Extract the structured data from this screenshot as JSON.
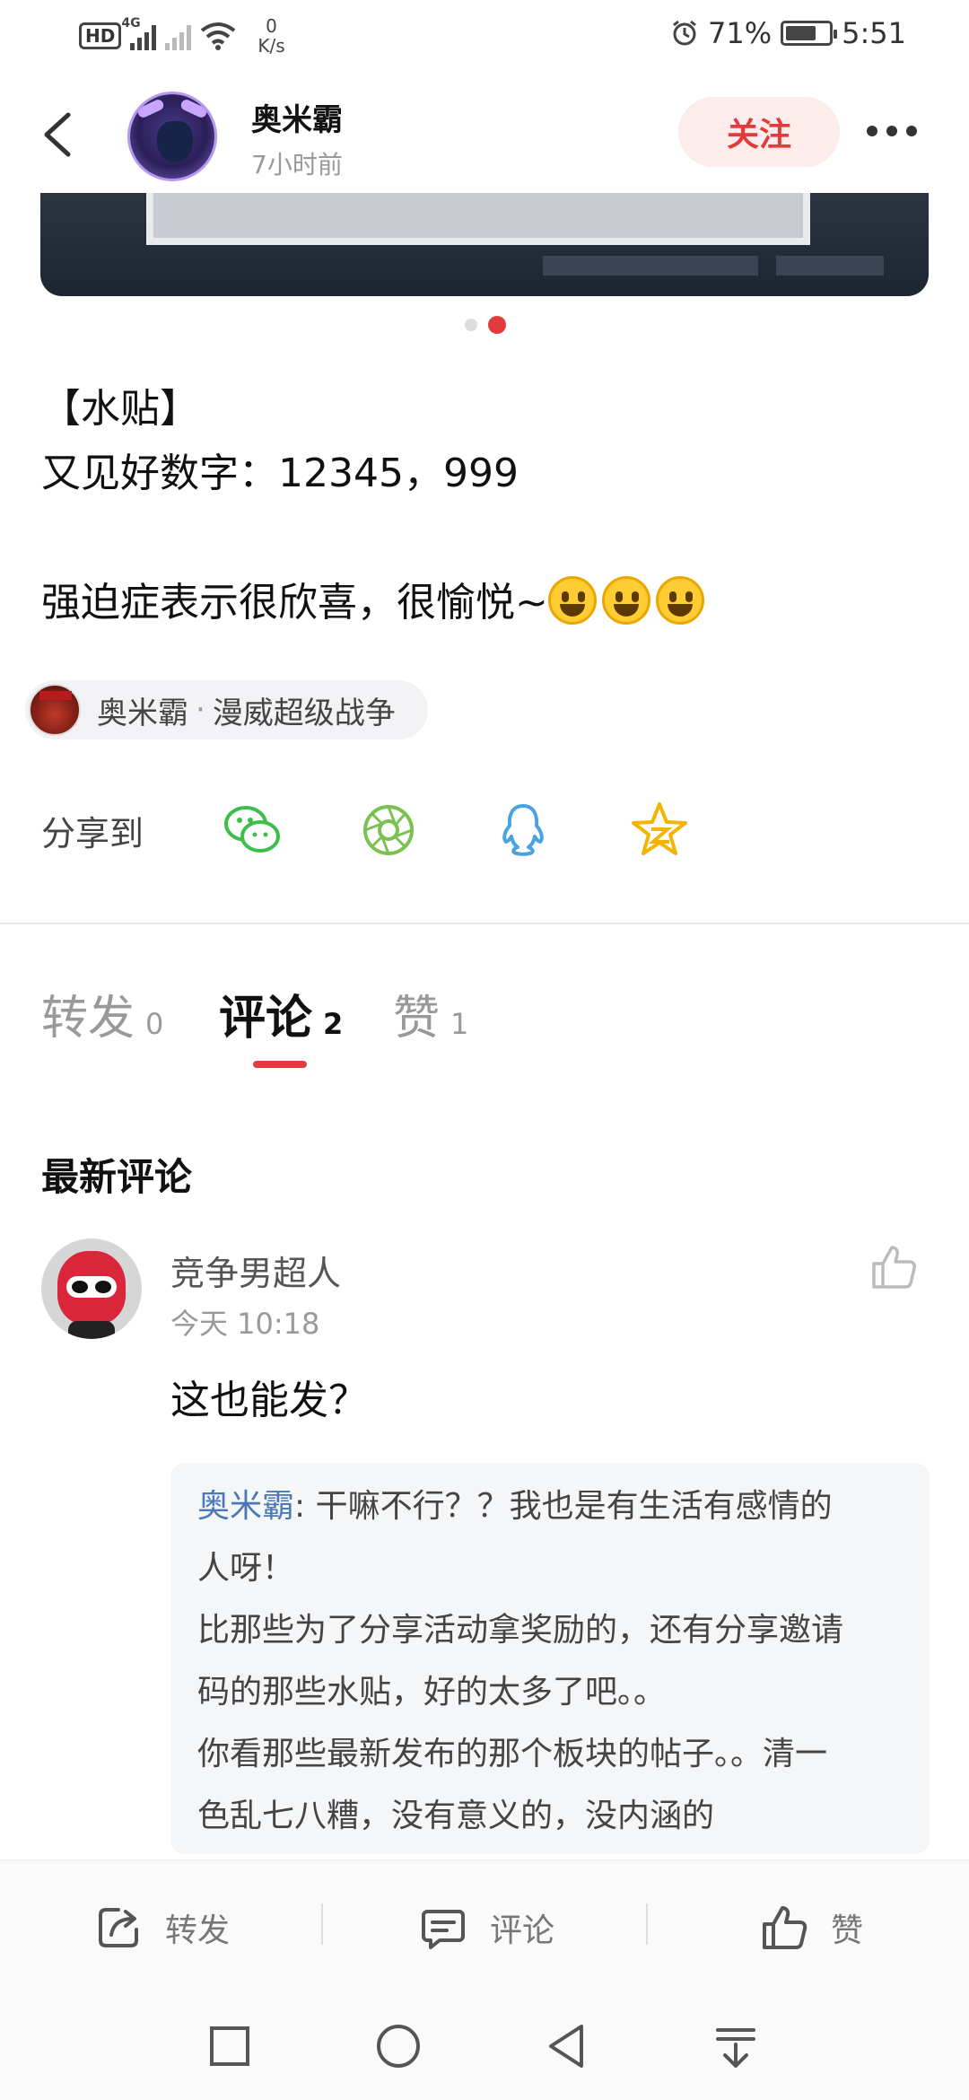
{
  "status_bar": {
    "hd": "HD",
    "network": "4G",
    "speed_value": "0",
    "speed_unit": "K/s",
    "battery_percent": "71%",
    "battery_level": 0.71,
    "time": "5:51"
  },
  "header": {
    "author_name": "奥米霸",
    "post_time": "7小时前",
    "follow_label": "关注"
  },
  "carousel": {
    "total": 2,
    "active_index": 1
  },
  "post": {
    "line1": "【水贴】",
    "line2": "又见好数字：12345，999",
    "line3": "",
    "line4": "强迫症表示很欣喜，很愉悦~"
  },
  "topic": {
    "author": "奥米霸",
    "separator": "·",
    "game": "漫威超级战争"
  },
  "share": {
    "label": "分享到",
    "targets": [
      "wechat-icon",
      "moments-icon",
      "qq-icon",
      "qzone-icon"
    ]
  },
  "tabs": [
    {
      "label": "转发",
      "count": "0"
    },
    {
      "label": "评论",
      "count": "2"
    },
    {
      "label": "赞",
      "count": "1"
    }
  ],
  "comments_section": {
    "title": "最新评论"
  },
  "comment": {
    "user": "竞争男超人",
    "time": "今天 10:18",
    "text": "这也能发？",
    "reply_user": "奥米霸",
    "reply_colon": ": ",
    "reply_lines": [
      "干嘛不行？？我也是有生活有感情的",
      "人呀！",
      "比那些为了分享活动拿奖励的，还有分享邀请",
      "码的那些水贴，好的太多了吧。。",
      "你看那些最新发布的那个板块的帖子。。清一",
      "色乱七八糟，没有意义的，没内涵的"
    ]
  },
  "actions": {
    "repost": "转发",
    "comment": "评论",
    "like": "赞"
  },
  "colors": {
    "accent": "#e33b3b",
    "reply_name": "#4a78b8"
  }
}
